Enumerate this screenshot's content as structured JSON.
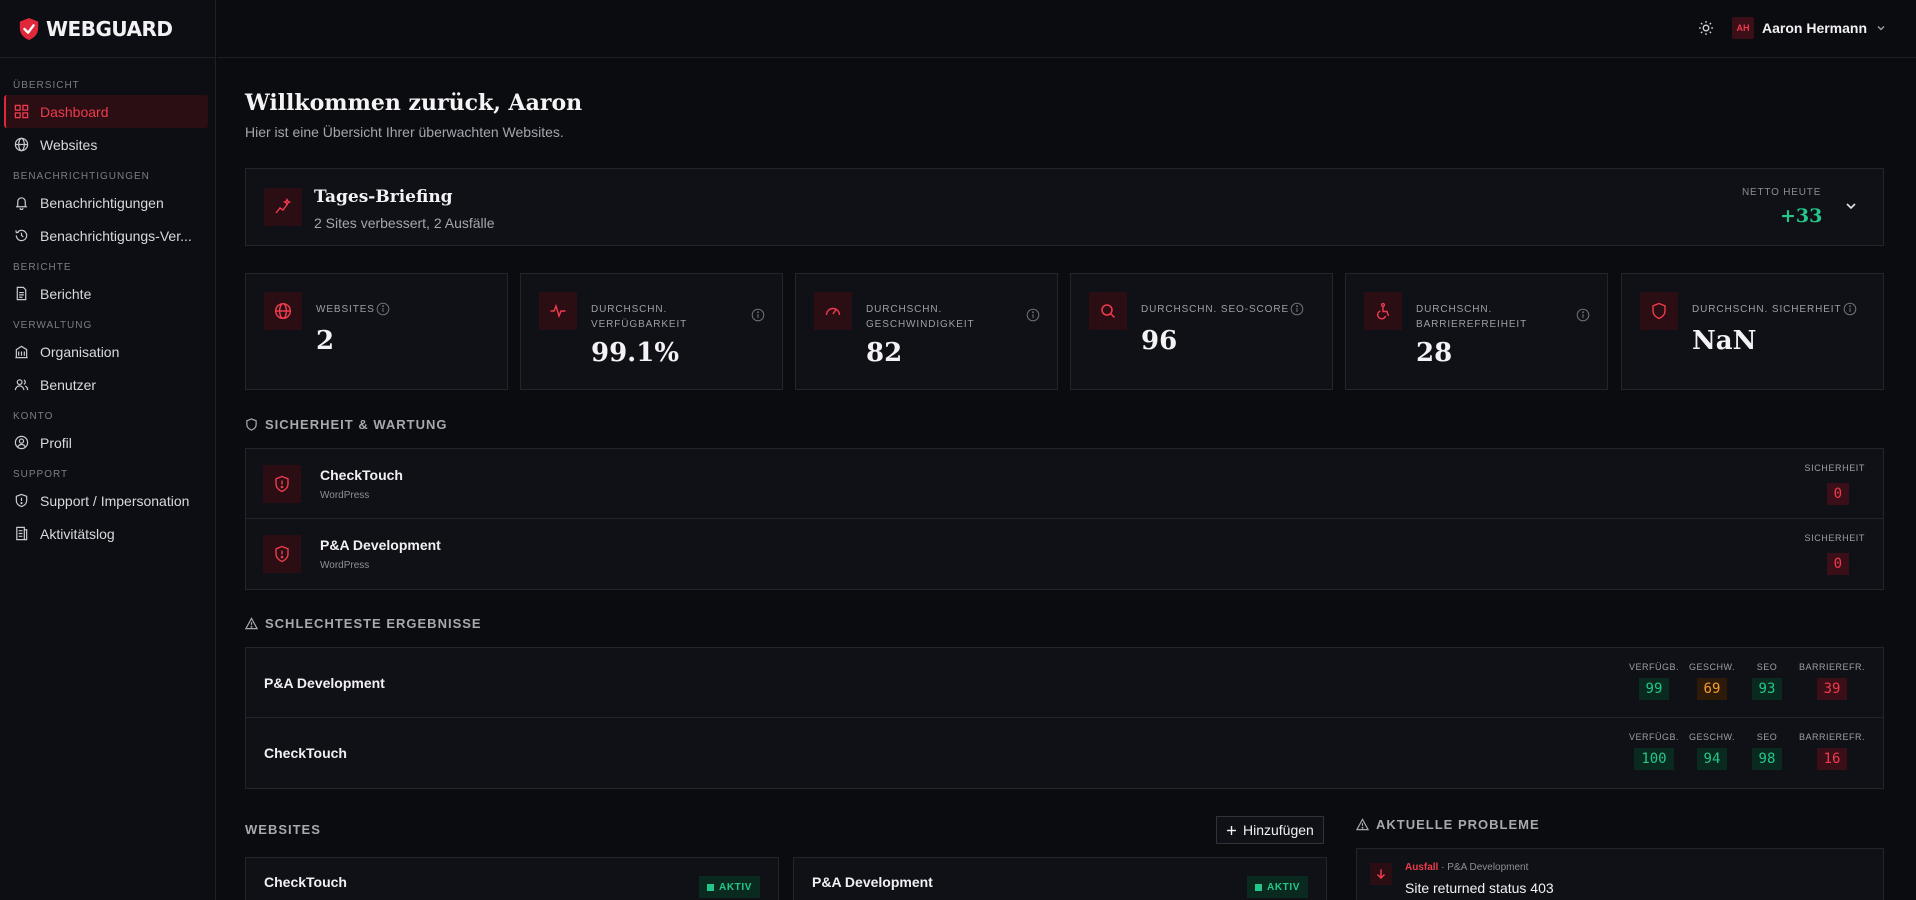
{
  "brand": {
    "name": "WEBGUARD"
  },
  "sidebar": {
    "sections": [
      {
        "title": "ÜBERSICHT",
        "items": [
          {
            "label": "Dashboard",
            "icon": "dashboard-icon",
            "active": true
          },
          {
            "label": "Websites",
            "icon": "globe-icon"
          }
        ]
      },
      {
        "title": "BENACHRICHTIGUNGEN",
        "items": [
          {
            "label": "Benachrichtigungen",
            "icon": "bell-icon"
          },
          {
            "label": "Benachrichtigungs-Ver...",
            "icon": "history-icon"
          }
        ]
      },
      {
        "title": "BERICHTE",
        "items": [
          {
            "label": "Berichte",
            "icon": "document-icon"
          }
        ]
      },
      {
        "title": "VERWALTUNG",
        "items": [
          {
            "label": "Organisation",
            "icon": "building-icon"
          },
          {
            "label": "Benutzer",
            "icon": "users-icon"
          }
        ]
      },
      {
        "title": "KONTO",
        "items": [
          {
            "label": "Profil",
            "icon": "user-circle-icon"
          }
        ]
      },
      {
        "title": "SUPPORT",
        "items": [
          {
            "label": "Support / Impersonation",
            "icon": "shield-alert-icon"
          },
          {
            "label": "Aktivitätslog",
            "icon": "log-icon"
          }
        ]
      }
    ]
  },
  "topbar": {
    "user_initials": "AH",
    "user_name": "Aaron Hermann"
  },
  "welcome": {
    "title": "Willkommen zurück, Aaron",
    "subtitle": "Hier ist eine Übersicht Ihrer überwachten Websites."
  },
  "briefing": {
    "title": "Tages-Briefing",
    "subtitle": "2 Sites verbessert, 2 Ausfälle",
    "netto_label": "NETTO HEUTE",
    "netto_value": "+33"
  },
  "stats": [
    {
      "label": "WEBSITES",
      "value": "2",
      "icon": "globe-icon"
    },
    {
      "label": "DURCHSCHN. VERFÜGBARKEIT",
      "value": "99.1%",
      "icon": "activity-icon"
    },
    {
      "label": "DURCHSCHN. GESCHWINDIGKEIT",
      "value": "82",
      "icon": "gauge-icon"
    },
    {
      "label": "DURCHSCHN. SEO-SCORE",
      "value": "96",
      "icon": "search-icon"
    },
    {
      "label": "DURCHSCHN. BARRIEREFREIHEIT",
      "value": "28",
      "icon": "accessibility-icon"
    },
    {
      "label": "DURCHSCHN. SICHERHEIT",
      "value": "NaN",
      "icon": "shield-icon"
    }
  ],
  "security": {
    "title": "SICHERHEIT & WARTUNG",
    "rows": [
      {
        "name": "CheckTouch",
        "platform": "WordPress",
        "metric_label": "SICHERHEIT",
        "value": "0"
      },
      {
        "name": "P&A Development",
        "platform": "WordPress",
        "metric_label": "SICHERHEIT",
        "value": "0"
      }
    ]
  },
  "worst": {
    "title": "SCHLECHTESTE ERGEBNISSE",
    "labels": [
      "VERFÜGB.",
      "GESCHW.",
      "SEO",
      "BARRIEREFR."
    ],
    "rows": [
      {
        "name": "P&A Development",
        "values": [
          "99",
          "69",
          "93",
          "39"
        ],
        "colors": [
          "green",
          "orange",
          "green",
          "red"
        ]
      },
      {
        "name": "CheckTouch",
        "values": [
          "100",
          "94",
          "98",
          "16"
        ],
        "colors": [
          "green",
          "green",
          "green",
          "red"
        ]
      }
    ]
  },
  "websites": {
    "title": "WEBSITES",
    "add_label": "Hinzufügen",
    "cards": [
      {
        "name": "CheckTouch",
        "status": "AKTIV"
      },
      {
        "name": "P&A Development",
        "status": "AKTIV"
      }
    ]
  },
  "problems": {
    "title": "AKTUELLE PROBLEME",
    "items": [
      {
        "type": "Ausfall",
        "site": "P&A Development",
        "text": "Site returned status 403"
      }
    ]
  }
}
